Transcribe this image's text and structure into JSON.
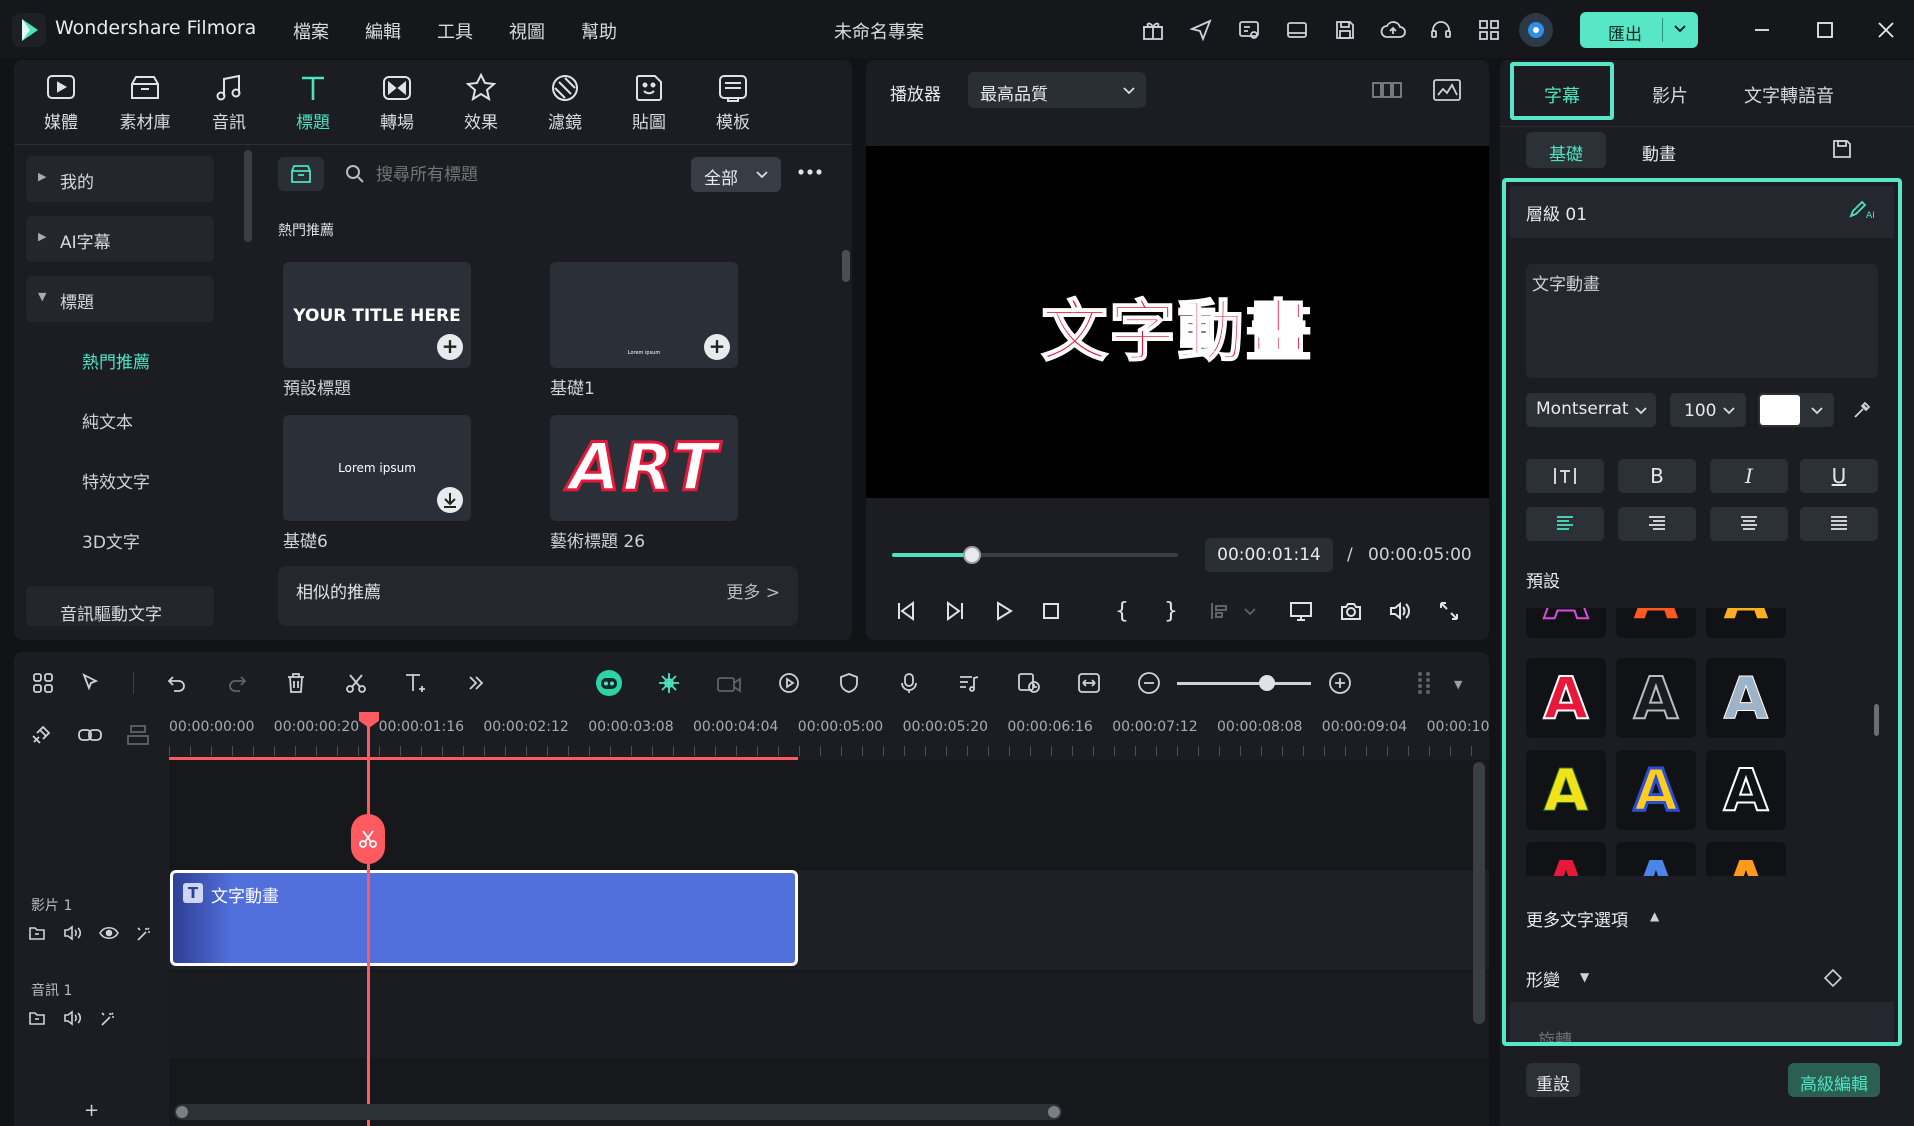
{
  "app": {
    "name": "Wondershare Filmora",
    "project_title": "未命名專案"
  },
  "menu": [
    "檔案",
    "編輯",
    "工具",
    "視圖",
    "幫助"
  ],
  "export": {
    "label": "匯出"
  },
  "colors": {
    "accent": "#4de3c1",
    "export_bg": "#57e7c6",
    "clip": "#5270dc",
    "playhead": "#ff5a5f",
    "title_red": "#e8183a"
  },
  "toolbar": [
    {
      "label": "媒體",
      "icon": "media-icon"
    },
    {
      "label": "素材庫",
      "icon": "stock-icon"
    },
    {
      "label": "音訊",
      "icon": "music-icon"
    },
    {
      "label": "標題",
      "icon": "title-icon",
      "active": true
    },
    {
      "label": "轉場",
      "icon": "transition-icon"
    },
    {
      "label": "效果",
      "icon": "effects-icon"
    },
    {
      "label": "濾鏡",
      "icon": "filter-icon"
    },
    {
      "label": "貼圖",
      "icon": "sticker-icon"
    },
    {
      "label": "模板",
      "icon": "template-icon"
    }
  ],
  "sidebar": {
    "categories": [
      "我的",
      "AI字幕",
      "標題"
    ],
    "subitems": [
      "熱門推薦",
      "純文本",
      "特效文字",
      "3D文字"
    ],
    "bottom": "音訊驅動文字"
  },
  "library": {
    "search_placeholder": "搜尋所有標題",
    "filter": "全部",
    "section_title": "熱門推薦",
    "cards": [
      {
        "label": "預設標題",
        "preview_text": "YOUR TITLE HERE"
      },
      {
        "label": "基礎1",
        "preview_text": "Lorem ipsum"
      },
      {
        "label": "基礎6",
        "preview_text": "Lorem ipsum"
      },
      {
        "label": "藝術標題 26",
        "preview_text": "ART"
      }
    ],
    "similar_title": "相似的推薦",
    "more": "更多 >"
  },
  "player": {
    "label": "播放器",
    "quality": "最高品質",
    "preview_text": "文字動畫",
    "current_time": "00:00:01:14",
    "separator": "/",
    "total_time": "00:00:05:00",
    "progress": 0.28
  },
  "right_panel": {
    "tabs": [
      "字幕",
      "影片",
      "文字轉語音"
    ],
    "subtabs": [
      "基礎",
      "動畫"
    ],
    "layer": "層級 01",
    "text_value": "文字動畫",
    "font": "Montserrat",
    "size": "100",
    "bold": "B",
    "italic": "I",
    "underline": "U",
    "presets_label": "預設",
    "more_options": "更多文字選項",
    "transform": "形變",
    "rotate": "旋轉",
    "reset": "重設",
    "advanced": "高級編輯"
  },
  "timeline": {
    "ruler": [
      "00:00:00:00",
      "00:00:00:20",
      "00:00:01:16",
      "00:00:02:12",
      "00:00:03:08",
      "00:00:04:04",
      "00:00:05:00",
      "00:00:05:20",
      "00:00:06:16",
      "00:00:07:12",
      "00:00:08:08",
      "00:00:09:04",
      "00:00:10"
    ],
    "tracks": [
      {
        "label": "影片 1"
      },
      {
        "label": "音訊 1"
      }
    ],
    "clip": {
      "label": "文字動畫"
    },
    "add": "+"
  }
}
